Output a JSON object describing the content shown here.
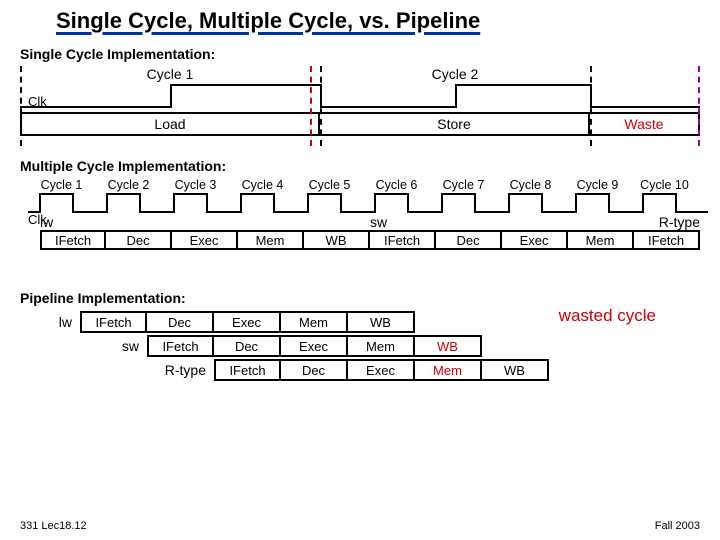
{
  "title": "Single Cycle, Multiple Cycle, vs. Pipeline",
  "sections": {
    "single": "Single Cycle Implementation:",
    "multi": "Multiple Cycle Implementation:",
    "pipe": "Pipeline Implementation:"
  },
  "clk_label": "Clk",
  "single_cycle": {
    "cycles": [
      "Cycle 1",
      "Cycle 2"
    ],
    "boxes": [
      "Load",
      "Store",
      "Waste"
    ]
  },
  "multi_cycle": {
    "cycles": [
      "Cycle 1",
      "Cycle 2",
      "Cycle 3",
      "Cycle 4",
      "Cycle 5",
      "Cycle 6",
      "Cycle 7",
      "Cycle 8",
      "Cycle 9",
      "Cycle 10"
    ],
    "instr_tags": [
      "lw",
      "sw",
      "R-type"
    ],
    "stages": {
      "lw": [
        "IFetch",
        "Dec",
        "Exec",
        "Mem",
        "WB"
      ],
      "sw": [
        "IFetch",
        "Dec",
        "Exec",
        "Mem"
      ],
      "rtype": [
        "IFetch"
      ]
    }
  },
  "pipeline": {
    "rows": [
      {
        "tag": "lw",
        "stages": [
          "IFetch",
          "Dec",
          "Exec",
          "Mem",
          "WB"
        ]
      },
      {
        "tag": "sw",
        "stages": [
          "IFetch",
          "Dec",
          "Exec",
          "Mem",
          "WB"
        ]
      },
      {
        "tag": "R-type",
        "stages": [
          "IFetch",
          "Dec",
          "Exec",
          "Mem",
          "WB"
        ]
      }
    ],
    "wasted_label": "wasted cycle"
  },
  "footer": {
    "left": "331 Lec18.12",
    "right": "Fall 2003"
  }
}
